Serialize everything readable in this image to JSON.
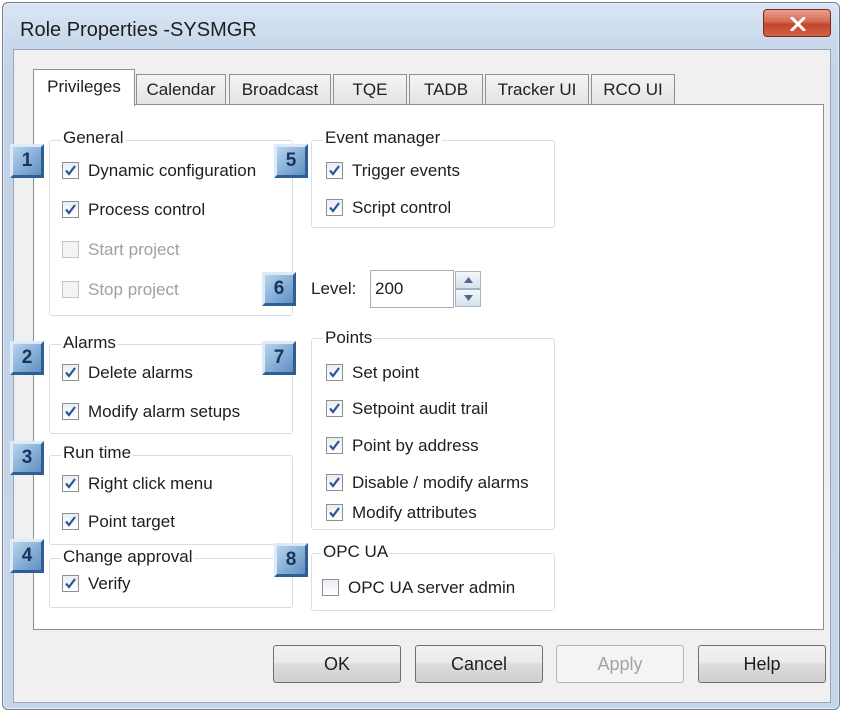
{
  "window": {
    "title": "Role Properties -SYSMGR",
    "close_icon": "close-x-icon"
  },
  "tabs": [
    {
      "label": "Privileges",
      "active": true
    },
    {
      "label": "Calendar"
    },
    {
      "label": "Broadcast"
    },
    {
      "label": "TQE"
    },
    {
      "label": "TADB"
    },
    {
      "label": "Tracker UI"
    },
    {
      "label": "RCO UI"
    }
  ],
  "groups": {
    "general": {
      "title": "General",
      "items": [
        {
          "label": "Dynamic configuration",
          "checked": true
        },
        {
          "label": "Process control",
          "checked": true
        },
        {
          "label": "Start project",
          "checked": false,
          "disabled": true
        },
        {
          "label": "Stop project",
          "checked": false,
          "disabled": true
        }
      ]
    },
    "alarms": {
      "title": "Alarms",
      "items": [
        {
          "label": "Delete alarms",
          "checked": true
        },
        {
          "label": "Modify alarm setups",
          "checked": true
        }
      ]
    },
    "runtime": {
      "title": "Run time",
      "items": [
        {
          "label": "Right click menu",
          "checked": true
        },
        {
          "label": "Point target",
          "checked": true
        }
      ]
    },
    "change_approval": {
      "title": "Change approval",
      "items": [
        {
          "label": "Verify",
          "checked": true
        }
      ]
    },
    "event_manager": {
      "title": "Event manager",
      "items": [
        {
          "label": "Trigger events",
          "checked": true
        },
        {
          "label": "Script control",
          "checked": true
        }
      ]
    },
    "points": {
      "title": "Points",
      "items": [
        {
          "label": "Set point",
          "checked": true
        },
        {
          "label": "Setpoint audit trail",
          "checked": true
        },
        {
          "label": "Point by address",
          "checked": true
        },
        {
          "label": "Disable / modify alarms",
          "checked": true
        },
        {
          "label": "Modify attributes",
          "checked": true
        }
      ]
    },
    "opc_ua": {
      "title": "OPC UA",
      "items": [
        {
          "label": "OPC UA server admin",
          "checked": false
        }
      ]
    }
  },
  "level": {
    "label": "Level:",
    "value": "200"
  },
  "markers": [
    "1",
    "2",
    "3",
    "4",
    "5",
    "6",
    "7",
    "8"
  ],
  "buttons": {
    "ok": "OK",
    "cancel": "Cancel",
    "apply": "Apply",
    "help": "Help"
  },
  "colors": {
    "marker_fill": "#86aed6",
    "marker_text": "#17365d",
    "check": "#2b5796",
    "close_button": "#c3452b"
  }
}
